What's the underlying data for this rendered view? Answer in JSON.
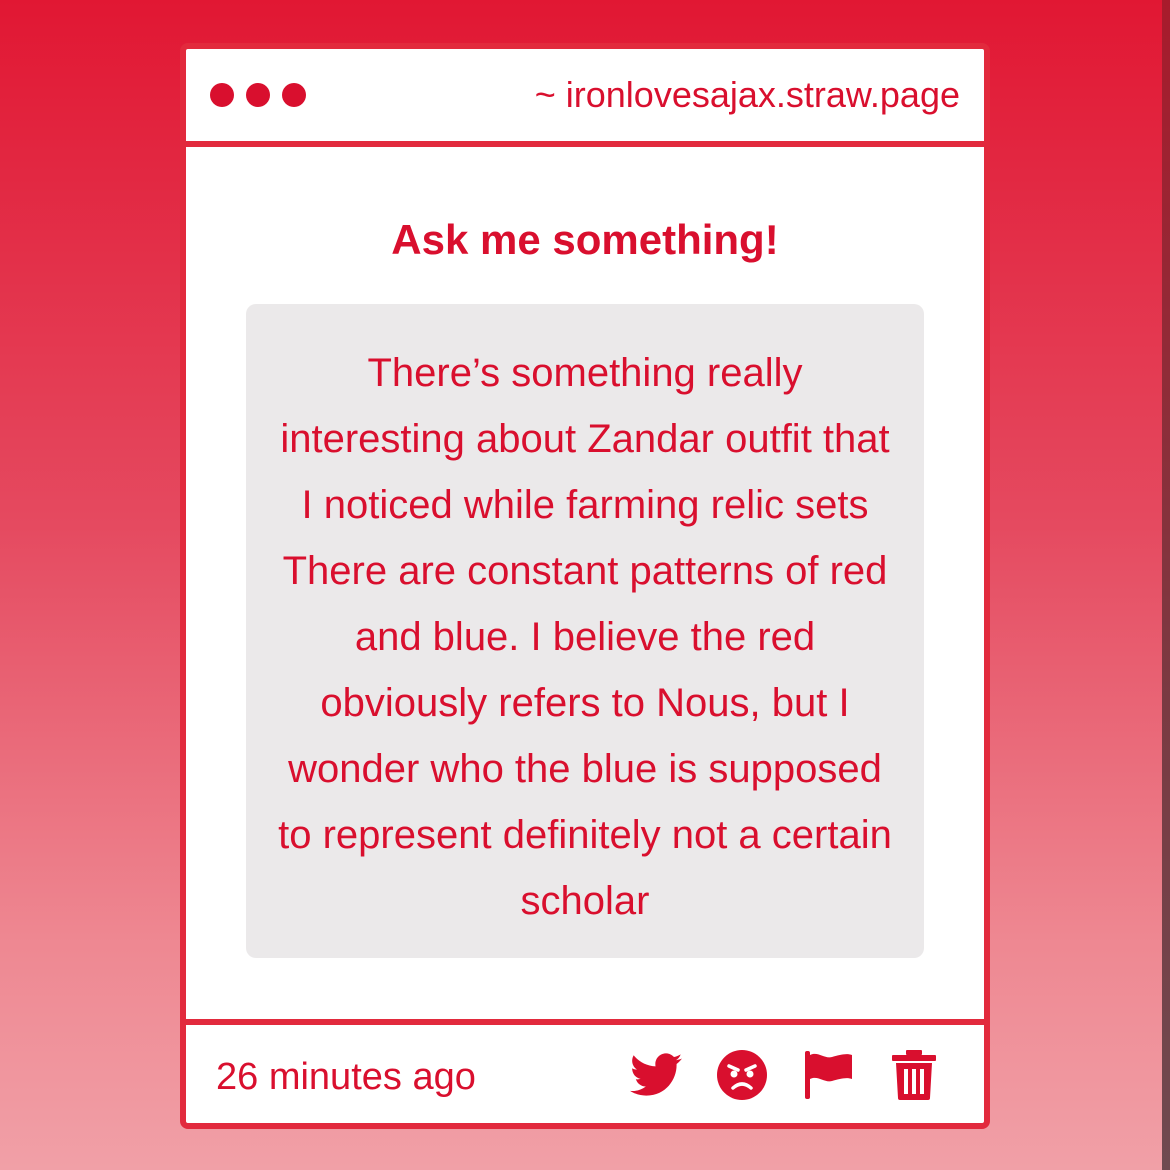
{
  "window": {
    "url": "~ ironlovesajax.straw.page"
  },
  "heading": "Ask me something!",
  "question": {
    "text": "There’s something really interesting about Zandar outfit that I noticed while farming relic sets There are constant patterns of red and blue. I believe the red obviously refers to Nous, but I wonder who the blue is supposed to represent definitely not a certain scholar"
  },
  "footer": {
    "timestamp": "26 minutes ago",
    "actions": [
      {
        "icon": "twitter-icon"
      },
      {
        "icon": "angry-face-icon"
      },
      {
        "icon": "flag-icon"
      },
      {
        "icon": "trash-icon"
      }
    ]
  },
  "colors": {
    "accent": "#d90f2e",
    "border": "#e22a3d",
    "question_bg": "#ebe9ea",
    "card_bg": "#ffffff"
  }
}
